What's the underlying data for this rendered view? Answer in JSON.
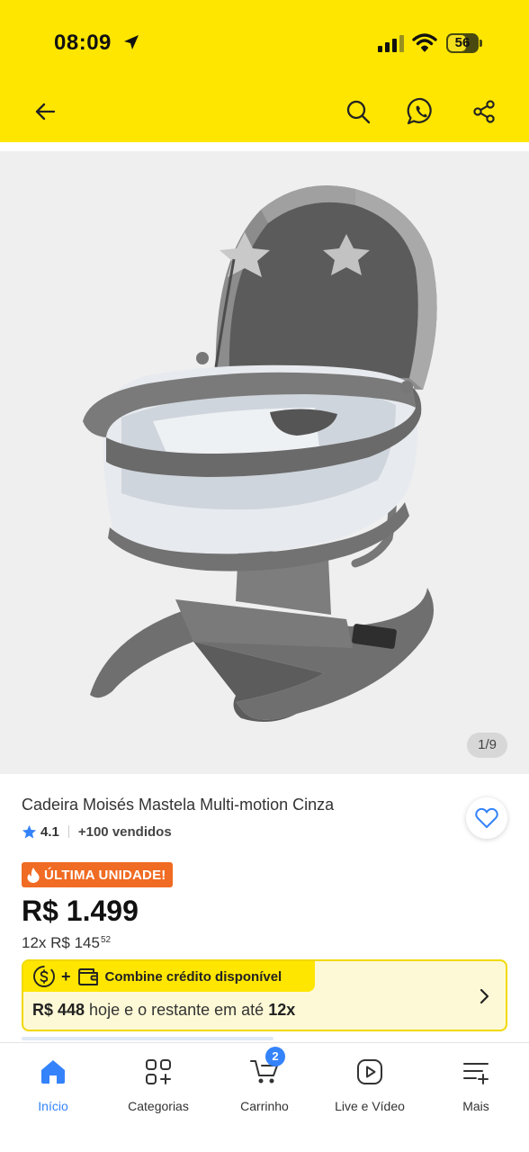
{
  "status_bar": {
    "time": "08:09",
    "battery": "56"
  },
  "navbar": {
    "icons": [
      "arrow-left-icon",
      "search-icon",
      "whatsapp-icon",
      "share-icon"
    ]
  },
  "gallery": {
    "counter": "1/9"
  },
  "product": {
    "title": "Cadeira Moisés Mastela Multi-motion Cinza",
    "rating": "4.1",
    "sold": "+100 vendidos",
    "badge": "ÚLTIMA UNIDADE!",
    "price": "R$ 1.499",
    "installment_prefix": "12x R$ 145",
    "installment_cents": "52"
  },
  "credit": {
    "plus": "+",
    "headline": "Combine crédito disponível",
    "amount_today": "R$ 448",
    "rest_text": " hoje e o restante em até ",
    "installments": "12x"
  },
  "tabbar": {
    "items": [
      {
        "label": "Início",
        "icon": "home-icon",
        "active": true
      },
      {
        "label": "Categorias",
        "icon": "grid-icon"
      },
      {
        "label": "Carrinho",
        "icon": "cart-icon",
        "badge": "2"
      },
      {
        "label": "Live e Vídeo",
        "icon": "play-icon"
      },
      {
        "label": "Mais",
        "icon": "menu-plus-icon"
      }
    ]
  },
  "colors": {
    "header": "#ffe600",
    "accent": "#3483fa",
    "badge": "#f06b23",
    "credit_bg": "#fdf9d6"
  }
}
